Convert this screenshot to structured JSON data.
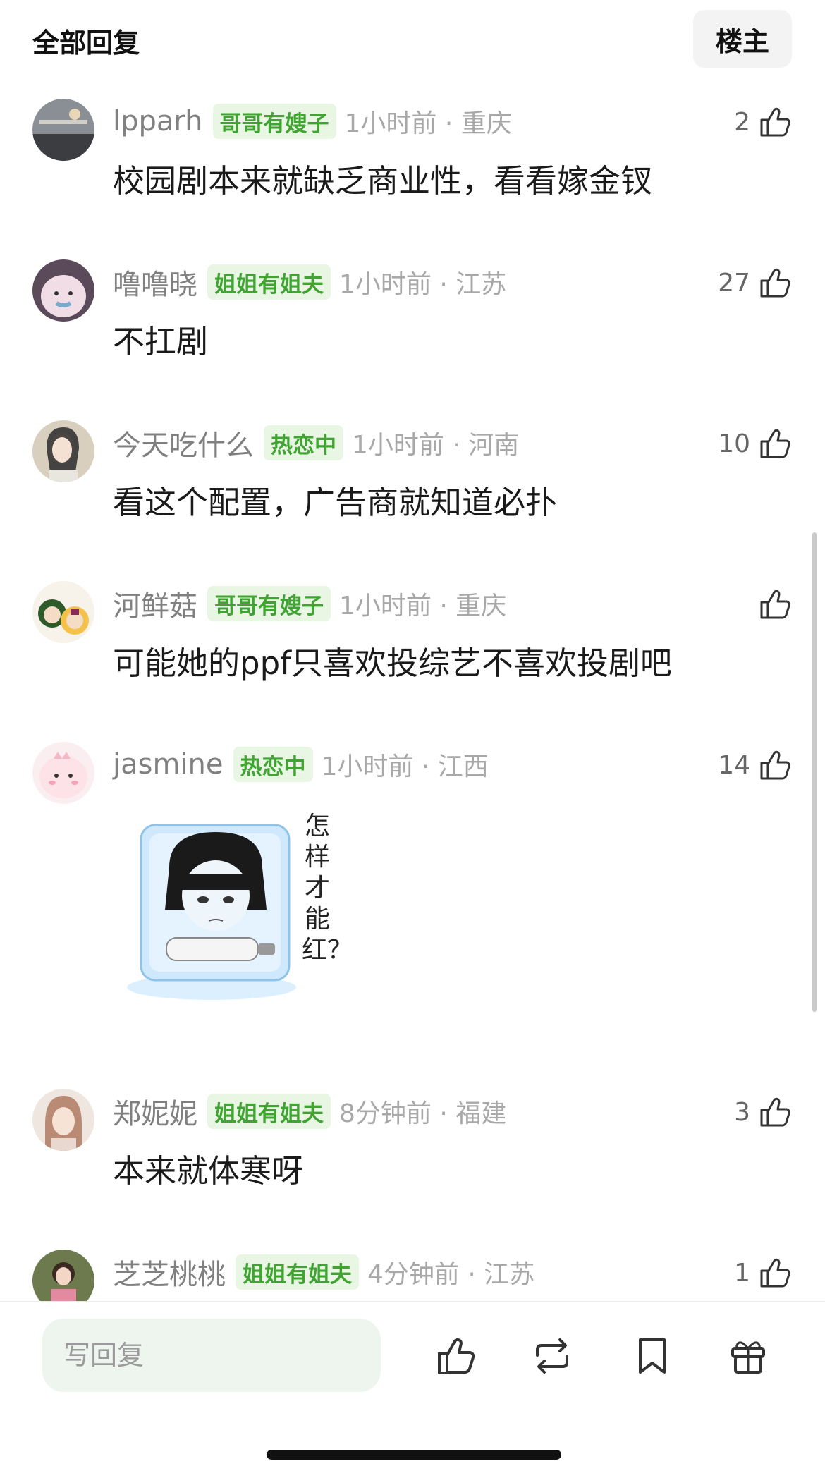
{
  "header": {
    "title": "全部回复",
    "filter_label": "楼主"
  },
  "comments": [
    {
      "username": "lpparh",
      "tag": "哥哥有嫂子",
      "time": "1小时前 · 重庆",
      "text": "校园剧本来就缺乏商业性，看看嫁金钗",
      "likes": "2"
    },
    {
      "username": "噜噜晓",
      "tag": "姐姐有姐夫",
      "time": "1小时前 · 江苏",
      "text": "不扛剧",
      "likes": "27"
    },
    {
      "username": "今天吃什么",
      "tag": "热恋中",
      "time": "1小时前 · 河南",
      "text": "看这个配置，广告商就知道必扑",
      "likes": "10"
    },
    {
      "username": "河鲜菇",
      "tag": "哥哥有嫂子",
      "time": "1小时前 · 重庆",
      "text": "可能她的ppf只喜欢投综艺不喜欢投剧吧",
      "likes": ""
    },
    {
      "username": "jasmine",
      "tag": "热恋中",
      "time": "1小时前 · 江西",
      "text": "",
      "likes": "14",
      "sticker_text": "怎样才能红？"
    },
    {
      "username": "郑妮妮",
      "tag": "姐姐有姐夫",
      "time": "8分钟前 · 福建",
      "text": "本来就体寒呀",
      "likes": "3"
    },
    {
      "username": "芝芝桃桃",
      "tag": "姐姐有姐夫",
      "time": "4分钟前 · 江苏",
      "text": "",
      "likes": "1"
    }
  ],
  "bottom_bar": {
    "reply_placeholder": "写回复"
  },
  "icons": {
    "like": "thumbs-up-icon",
    "repost": "repost-icon",
    "bookmark": "bookmark-icon",
    "gift": "gift-icon"
  },
  "colors": {
    "tag_bg": "#e8f6e3",
    "tag_text": "#3fa431",
    "meta_text": "#a8a8a8"
  }
}
